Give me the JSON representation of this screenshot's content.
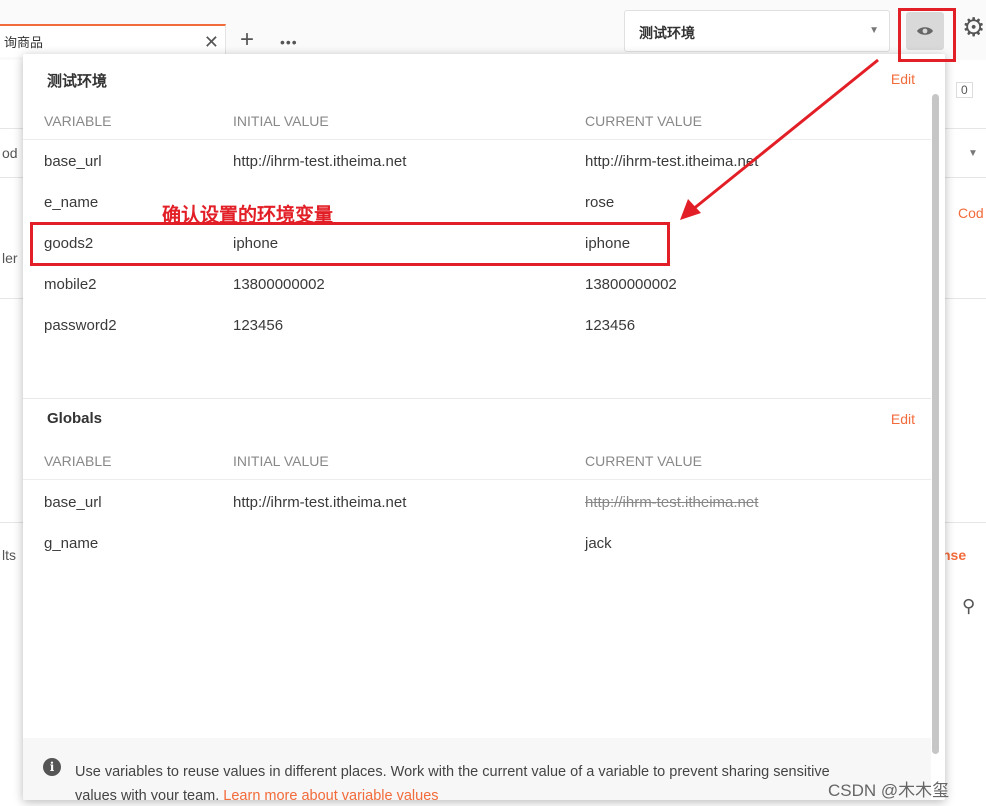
{
  "tab": {
    "label": "询商品",
    "close": "✕",
    "add": "+",
    "more": "•••"
  },
  "environment": {
    "selected": "测试环境",
    "caret": "▼"
  },
  "icons": {
    "eye": "eye-icon",
    "gear": "gear-icon",
    "info": "info-icon"
  },
  "background": {
    "frag_num": "0",
    "frag_code": "Cod",
    "frag_nse": "nse",
    "frag_od": "od",
    "frag_ler": "ler",
    "frag_lts": "lts"
  },
  "popup": {
    "env_section": {
      "title": "测试环境",
      "edit": "Edit",
      "columns": [
        "VARIABLE",
        "INITIAL VALUE",
        "CURRENT VALUE"
      ],
      "rows": [
        {
          "variable": "base_url",
          "initial": "http://ihrm-test.itheima.net",
          "current": "http://ihrm-test.itheima.net"
        },
        {
          "variable": "e_name",
          "initial": "",
          "current": "rose"
        },
        {
          "variable": "goods2",
          "initial": "iphone",
          "current": "iphone"
        },
        {
          "variable": "mobile2",
          "initial": "13800000002",
          "current": "13800000002"
        },
        {
          "variable": "password2",
          "initial": "123456",
          "current": "123456"
        }
      ]
    },
    "globals_section": {
      "title": "Globals",
      "edit": "Edit",
      "columns": [
        "VARIABLE",
        "INITIAL VALUE",
        "CURRENT VALUE"
      ],
      "rows": [
        {
          "variable": "base_url",
          "initial": "http://ihrm-test.itheima.net",
          "current": "http://ihrm-test.itheima.net"
        },
        {
          "variable": "g_name",
          "initial": "",
          "current": "jack"
        }
      ]
    },
    "footer": {
      "text": "Use variables to reuse values in different places. Work with the current value of a variable to prevent sharing sensitive values with your team.",
      "link": "Learn more about variable values"
    }
  },
  "annotation": {
    "label": "确认设置的环境变量",
    "color": "#e21f26"
  },
  "watermark": "CSDN @木木玺",
  "colors": {
    "accent": "#f26b3a",
    "annotation": "#e21f26"
  }
}
